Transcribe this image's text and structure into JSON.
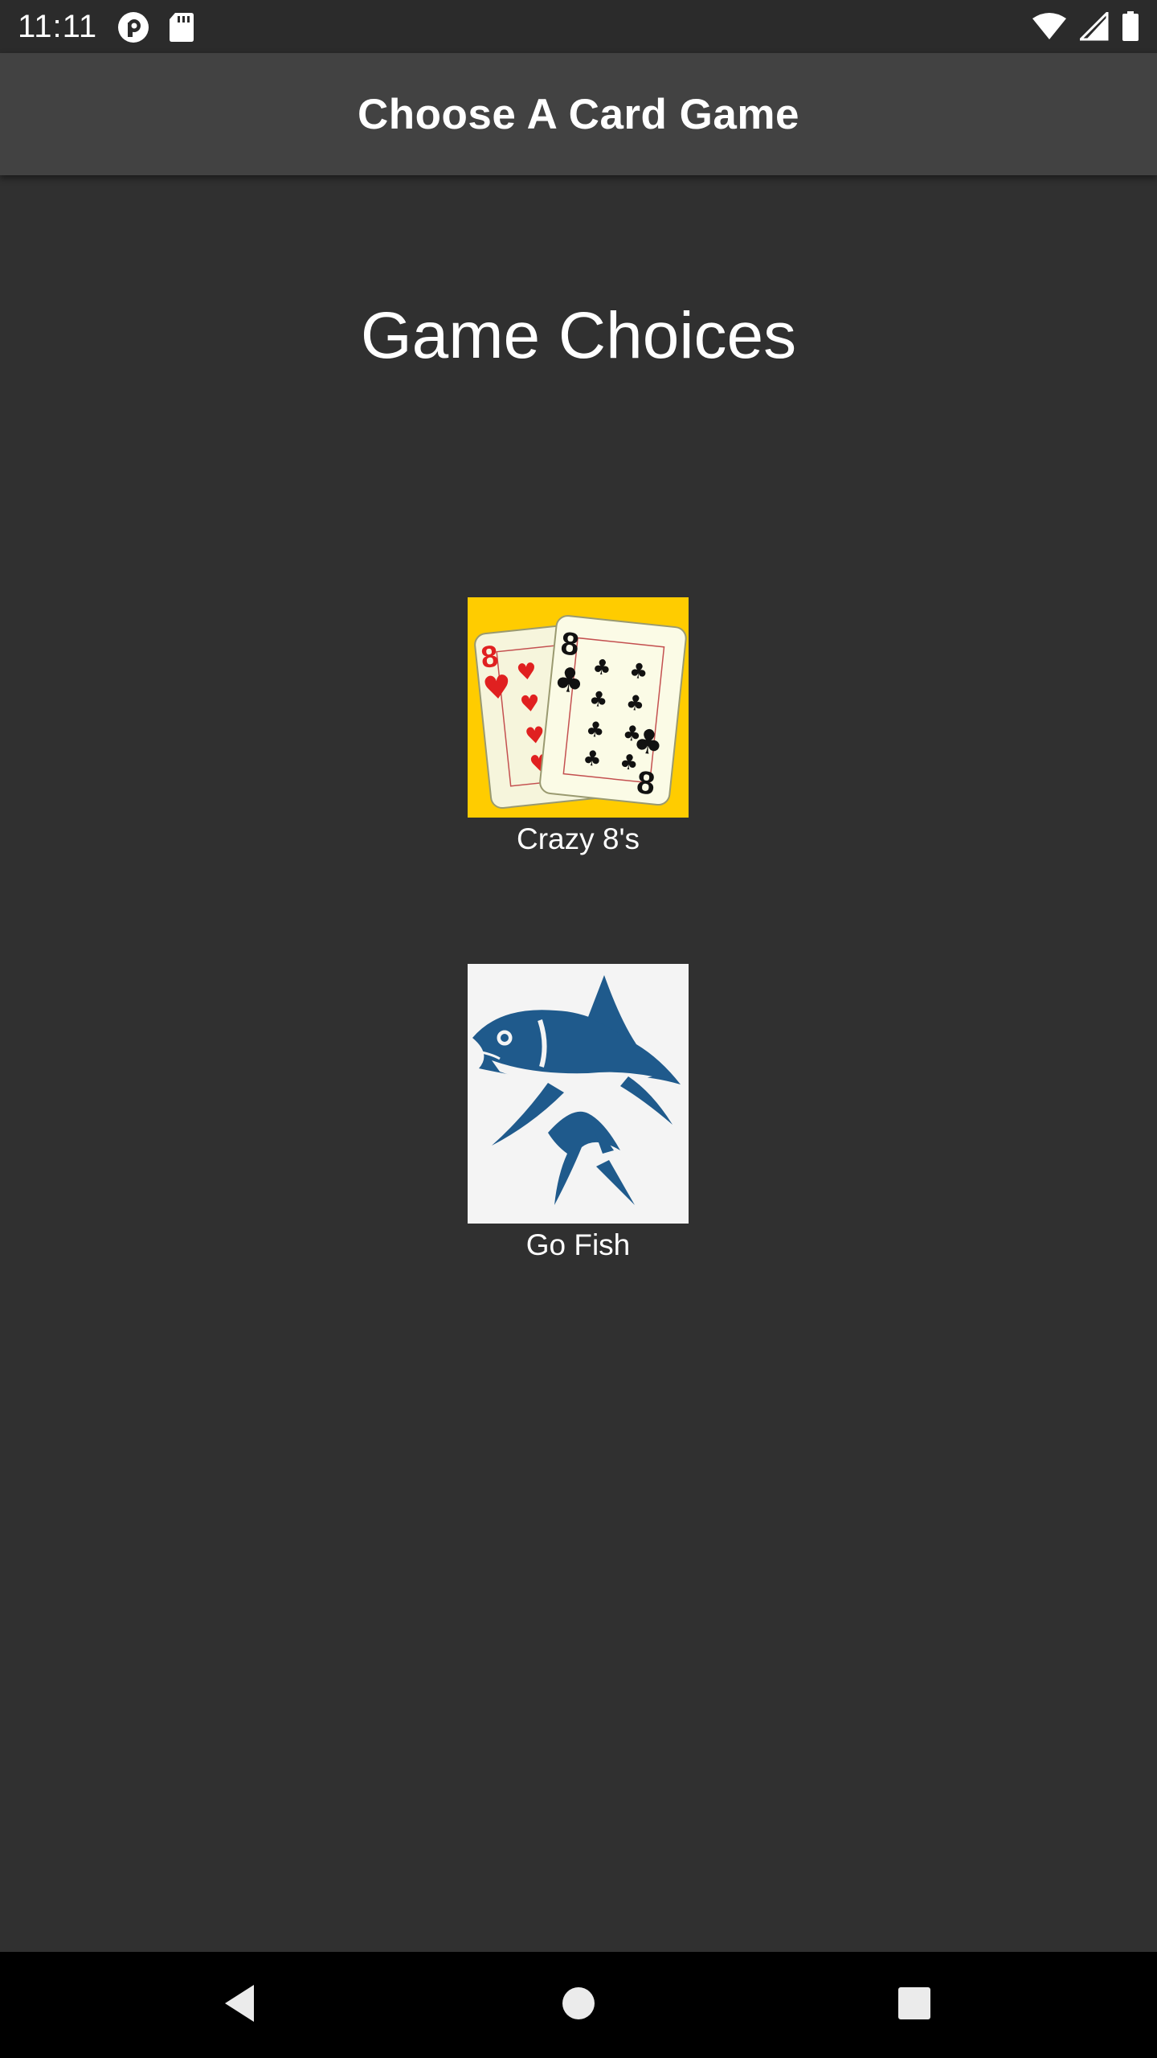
{
  "status_bar": {
    "time": "11:11",
    "left_icons": [
      "pocket-casts-icon",
      "sd-card-icon"
    ],
    "right_icons": [
      "wifi-icon",
      "cell-signal-icon",
      "battery-icon"
    ]
  },
  "app_bar": {
    "title": "Choose A Card Game"
  },
  "main": {
    "heading": "Game Choices",
    "games": [
      {
        "label": "Crazy 8's",
        "image": "crazy-eights-cards-image",
        "background": "#ffcc00"
      },
      {
        "label": "Go Fish",
        "image": "tuna-fish-image",
        "background": "#f4f4f4"
      }
    ]
  },
  "nav_bar": {
    "buttons": [
      "back-icon",
      "home-icon",
      "recents-icon"
    ]
  },
  "colors": {
    "background": "#303030",
    "app_bar": "#424242",
    "status_bar": "#2b2b2b",
    "nav_bar": "#000000",
    "fish_blue": "#1f5a8c",
    "heart_red": "#e02020"
  }
}
